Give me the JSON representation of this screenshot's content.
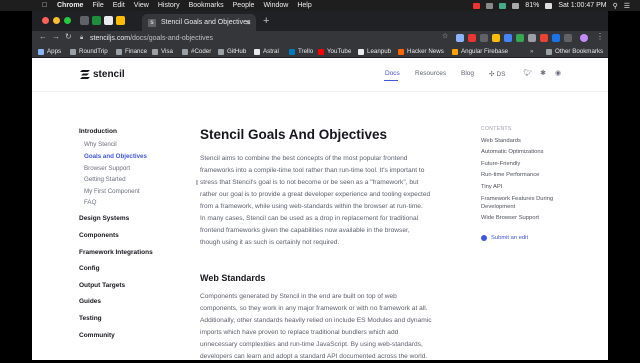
{
  "menubar": {
    "app": "Chrome",
    "items": [
      "File",
      "Edit",
      "View",
      "History",
      "Bookmarks",
      "People",
      "Window",
      "Help"
    ],
    "battery": "81%",
    "clock": "Sat 1:00:47 PM"
  },
  "browser": {
    "tab_title": "Stencil Goals and Objectives",
    "url_host": "stenciljs.com",
    "url_path": "/docs/goals-and-objectives",
    "bookmarks": [
      "Apps",
      "RoundTrip",
      "Finance",
      "Visa",
      "#Coder",
      "GitHub",
      "Astral",
      "Trello",
      "YouTube",
      "Leanpub",
      "Hacker News",
      "Angular Firebase"
    ],
    "other_bookmarks": "Other Bookmarks",
    "colors": {
      "chrome_dark": "#202124",
      "toolbar": "#35363a"
    }
  },
  "site": {
    "logo": "stencil",
    "nav": {
      "docs": "Docs",
      "resources": "Resources",
      "blog": "Blog",
      "ds": "DS"
    },
    "accent": "#3f55e4"
  },
  "sidebar": {
    "introduction": "Introduction",
    "intro_items": [
      "Why Stencil",
      "Goals and Objectives",
      "Browser Support",
      "Getting Started",
      "My First Component",
      "FAQ"
    ],
    "sections": [
      "Design Systems",
      "Components",
      "Framework Integrations",
      "Config",
      "Output Targets",
      "Guides",
      "Testing",
      "Community"
    ]
  },
  "main": {
    "title": "Stencil Goals And Objectives",
    "intro_lines": [
      "Stencil aims to combine the best concepts of the most popular frontend",
      "frameworks into a compile-time tool rather than run-time tool. It's important to",
      "stress that Stencil's goal is to not become or be seen as a \"framework\", but",
      "rather our goal is to provide a great developer experience and tooling expected",
      "from a framework, while using web-standards within the browser at run-time.",
      "In many cases, Stencil can be used as a drop in replacement for traditional",
      "frontend frameworks given the capabilities now available in the browser,",
      "though using it as such is certainly not required."
    ],
    "web_standards_heading": "Web Standards",
    "ws_lines": [
      "Components generated by Stencil in the end are built on top of web",
      "components, so they work in any major framework or with no framework at all.",
      "Additionally, other standards heavily relied on include ES Modules and dynamic",
      "imports which have proven to replace traditional bundlers which add",
      "unnecessary complexities and run-time JavaScript. By using web-standards,",
      "developers can learn and adopt a standard API documented across the world."
    ]
  },
  "toc": {
    "heading": "CONTENTS",
    "items": [
      "Web Standards",
      "Automatic Optimizations",
      "Future-Friendly",
      "Run-time Performance",
      "Tiny API"
    ],
    "item_multiline_line1": "Framework Features During",
    "item_multiline_line2": "Development",
    "last_item": "Wide Browser Support",
    "edit_link": "Submit an edit"
  }
}
